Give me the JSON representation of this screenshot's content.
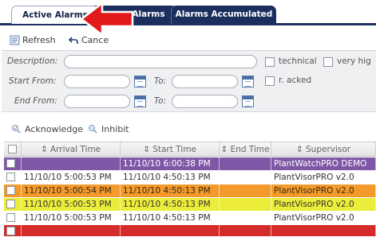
{
  "tabs": [
    {
      "label": "Active Alarms",
      "active": true
    },
    {
      "label": "Alarms",
      "active": false
    },
    {
      "label": "Alarms Accumulated",
      "active": false
    }
  ],
  "toolbar": {
    "refresh_label": "Refresh",
    "cancel_label": "Cance"
  },
  "filters": {
    "description_label": "Description:",
    "start_from_label": "Start From:",
    "to_label_1": "To:",
    "end_from_label": "End From:",
    "to_label_2": "To:",
    "checkbox_technical": "technical",
    "checkbox_very_high": "very hig",
    "checkbox_r_acked": "r. acked"
  },
  "actions": {
    "acknowledge_label": "Acknowledge",
    "inhibit_label": "Inhibit"
  },
  "grid": {
    "columns": [
      "",
      "Arrival Time",
      "Start Time",
      "End Time",
      "Supervisor"
    ],
    "rows": [
      {
        "arrival": "",
        "start": "11/10/10 6:00:38 PM",
        "end": "",
        "supervisor": "PlantWatchPRO DEMO",
        "color": "#7e57a6",
        "text_color": "#ffffff"
      },
      {
        "arrival": "11/10/10 5:00:53 PM",
        "start": "11/10/10 4:50:13 PM",
        "end": "",
        "supervisor": "PlantVisorPRO v2.0",
        "color": "#ffffff",
        "text_color": "#333333"
      },
      {
        "arrival": "11/10/10 5:00:54 PM",
        "start": "11/10/10 4:50:13 PM",
        "end": "",
        "supervisor": "PlantVisorPRO v2.0",
        "color": "#f39a2b",
        "text_color": "#3a2a10"
      },
      {
        "arrival": "11/10/10 5:00:53 PM",
        "start": "11/10/10 4:50:13 PM",
        "end": "",
        "supervisor": "PlantVisorPRO v2.0",
        "color": "#ecec3a",
        "text_color": "#333333"
      },
      {
        "arrival": "11/10/10 5:00:53 PM",
        "start": "11/10/10 4:50:13 PM",
        "end": "",
        "supervisor": "PlantVisorPRO v2.0",
        "color": "#ffffff",
        "text_color": "#333333"
      },
      {
        "arrival": "",
        "start": "",
        "end": "",
        "supervisor": "",
        "color": "#d62b2b",
        "text_color": "#ffffff"
      }
    ]
  },
  "colors": {
    "tab_dark": "#1b2f5e",
    "arrow_red": "#e11b1b"
  }
}
